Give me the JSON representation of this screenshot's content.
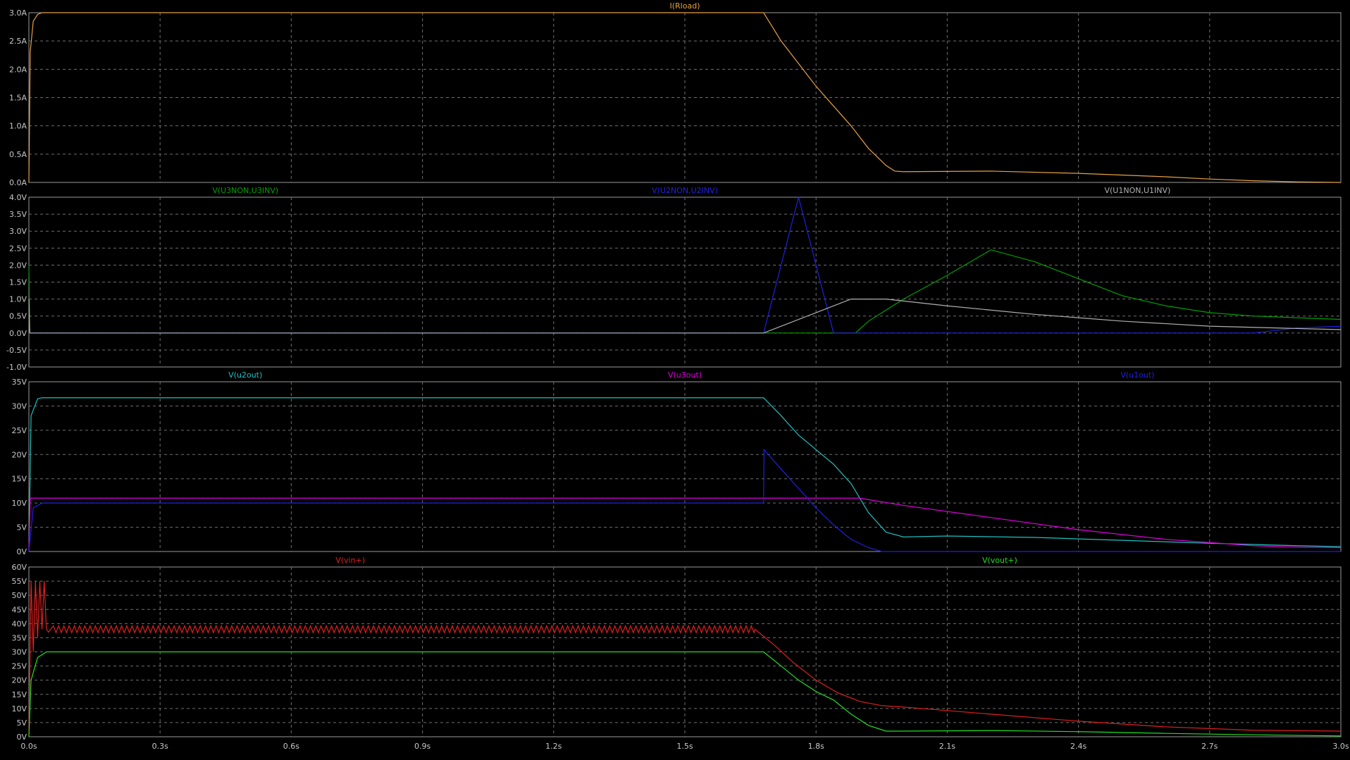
{
  "chart_data": [
    {
      "type": "line",
      "xlim": [
        0,
        3.0
      ],
      "xticks": [
        "0.0s",
        "0.3s",
        "0.6s",
        "0.9s",
        "1.2s",
        "1.5s",
        "1.8s",
        "2.1s",
        "2.4s",
        "2.7s",
        "3.0s"
      ],
      "ylim": [
        0,
        3.0
      ],
      "yticks": [
        "0.0A",
        "0.5A",
        "1.0A",
        "1.5A",
        "2.0A",
        "2.5A",
        "3.0A"
      ],
      "grid": true,
      "series": [
        {
          "name": "I(Rload)",
          "color": "#e8a040",
          "x": [
            0,
            0.003,
            0.01,
            0.02,
            0.03,
            1.68,
            1.72,
            1.76,
            1.8,
            1.84,
            1.88,
            1.92,
            1.96,
            1.98,
            2.0,
            2.2,
            2.4,
            2.6,
            2.7,
            2.8,
            2.9,
            3.0
          ],
          "y": [
            0,
            2.3,
            2.85,
            2.97,
            3.0,
            3.0,
            2.5,
            2.1,
            1.7,
            1.35,
            1.0,
            0.6,
            0.3,
            0.2,
            0.19,
            0.2,
            0.16,
            0.1,
            0.06,
            0.03,
            0.01,
            0.0
          ]
        }
      ]
    },
    {
      "type": "line",
      "xlim": [
        0,
        3.0
      ],
      "xticks": [
        "0.0s",
        "0.3s",
        "0.6s",
        "0.9s",
        "1.2s",
        "1.5s",
        "1.8s",
        "2.1s",
        "2.4s",
        "2.7s",
        "3.0s"
      ],
      "ylim": [
        -1.0,
        4.0
      ],
      "yticks": [
        "-1.0V",
        "-0.5V",
        "0.0V",
        "0.5V",
        "1.0V",
        "1.5V",
        "2.0V",
        "2.5V",
        "3.0V",
        "3.5V",
        "4.0V"
      ],
      "grid": true,
      "series": [
        {
          "name": "V(U3NON,U3INV)",
          "color": "#00a000",
          "x": [
            0,
            0.002,
            0.004,
            1.88,
            1.89,
            1.92,
            2.0,
            2.1,
            2.2,
            2.3,
            2.4,
            2.5,
            2.6,
            2.7,
            2.8,
            2.9,
            3.0
          ],
          "y": [
            2.0,
            0,
            0,
            0,
            0,
            0.35,
            1.0,
            1.7,
            2.45,
            2.1,
            1.6,
            1.1,
            0.8,
            0.6,
            0.5,
            0.45,
            0.4
          ]
        },
        {
          "name": "V(U2NON,U2INV)",
          "color": "#2020e0",
          "x": [
            0,
            1.68,
            1.76,
            1.84,
            2.8,
            2.9,
            3.0
          ],
          "y": [
            0,
            0,
            4.0,
            0,
            0,
            0.15,
            0.2
          ]
        },
        {
          "name": "V(U1NON,U1INV)",
          "color": "#b0b0b0",
          "x": [
            0,
            0.002,
            0.004,
            1.68,
            1.72,
            1.8,
            1.88,
            1.96,
            2.1,
            2.3,
            2.5,
            2.7,
            3.0
          ],
          "y": [
            1.0,
            0,
            0,
            0,
            0.2,
            0.6,
            1.0,
            1.0,
            0.8,
            0.55,
            0.35,
            0.2,
            0.1
          ]
        }
      ]
    },
    {
      "type": "line",
      "xlim": [
        0,
        3.0
      ],
      "xticks": [
        "0.0s",
        "0.3s",
        "0.6s",
        "0.9s",
        "1.2s",
        "1.5s",
        "1.8s",
        "2.1s",
        "2.4s",
        "2.7s",
        "3.0s"
      ],
      "ylim": [
        0,
        35
      ],
      "yticks": [
        "0V",
        "5V",
        "10V",
        "15V",
        "20V",
        "25V",
        "30V",
        "35V"
      ],
      "grid": true,
      "series": [
        {
          "name": "V(u2out)",
          "color": "#20c0c0",
          "x": [
            0,
            0.005,
            0.02,
            0.03,
            1.68,
            1.72,
            1.76,
            1.8,
            1.84,
            1.88,
            1.92,
            1.96,
            2.0,
            2.1,
            2.3,
            2.5,
            2.7,
            2.9,
            3.0
          ],
          "y": [
            0,
            28,
            31.5,
            31.7,
            31.7,
            28,
            24,
            21,
            18,
            14,
            8,
            4,
            3,
            3.2,
            2.9,
            2.3,
            1.7,
            1.2,
            1.0
          ]
        },
        {
          "name": "V(u3out)",
          "color": "#e000e0",
          "x": [
            0,
            0.003,
            1.88,
            1.9,
            2.0,
            2.2,
            2.4,
            2.6,
            2.8,
            2.9,
            3.0
          ],
          "y": [
            0,
            11,
            11,
            11,
            9.5,
            7,
            4.5,
            2.5,
            1.2,
            0.9,
            0.8
          ]
        },
        {
          "name": "V(u1out)",
          "color": "#2020e0",
          "x": [
            0,
            0.01,
            0.03,
            1.68,
            1.681,
            1.72,
            1.76,
            1.8,
            1.84,
            1.88,
            1.92,
            1.95,
            3.0
          ],
          "y": [
            0,
            9,
            10,
            10,
            21,
            17,
            13,
            9,
            5.5,
            2.5,
            0.8,
            0,
            0
          ]
        }
      ]
    },
    {
      "type": "line",
      "xlim": [
        0,
        3.0
      ],
      "xticks": [
        "0.0s",
        "0.3s",
        "0.6s",
        "0.9s",
        "1.2s",
        "1.5s",
        "1.8s",
        "2.1s",
        "2.4s",
        "2.7s",
        "3.0s"
      ],
      "ylim": [
        0,
        60
      ],
      "yticks": [
        "0V",
        "5V",
        "10V",
        "15V",
        "20V",
        "25V",
        "30V",
        "35V",
        "40V",
        "45V",
        "50V",
        "55V",
        "60V"
      ],
      "grid": true,
      "series": [
        {
          "name": "V(vin+)",
          "color": "#e02020",
          "x": [
            0,
            0.005,
            0.01,
            0.015,
            0.02,
            0.025,
            0.03,
            0.035,
            0.04,
            0.045,
            0.05,
            1.66,
            1.7,
            1.75,
            1.8,
            1.85,
            1.9,
            1.95,
            2.0,
            2.2,
            2.4,
            2.6,
            2.8,
            3.0
          ],
          "y": [
            0,
            55,
            30,
            55,
            35,
            55,
            38,
            55,
            38,
            37,
            38,
            38,
            33,
            26,
            20,
            15.5,
            12.5,
            11,
            10.5,
            8,
            5.5,
            3.5,
            2.3,
            2.0
          ],
          "ripple": {
            "amplitude": 1.2,
            "period": 0.012,
            "x_range": [
              0.05,
              1.66
            ]
          }
        },
        {
          "name": "V(vout+)",
          "color": "#20e020",
          "x": [
            0,
            0.005,
            0.02,
            0.04,
            1.68,
            1.72,
            1.76,
            1.8,
            1.84,
            1.88,
            1.92,
            1.96,
            2.0,
            2.2,
            2.4,
            2.6,
            2.8,
            3.0
          ],
          "y": [
            0,
            20,
            28,
            30,
            30,
            25,
            20,
            16,
            13,
            8,
            4,
            2,
            2,
            2.2,
            1.8,
            1.2,
            0.7,
            0.3
          ]
        }
      ]
    }
  ]
}
